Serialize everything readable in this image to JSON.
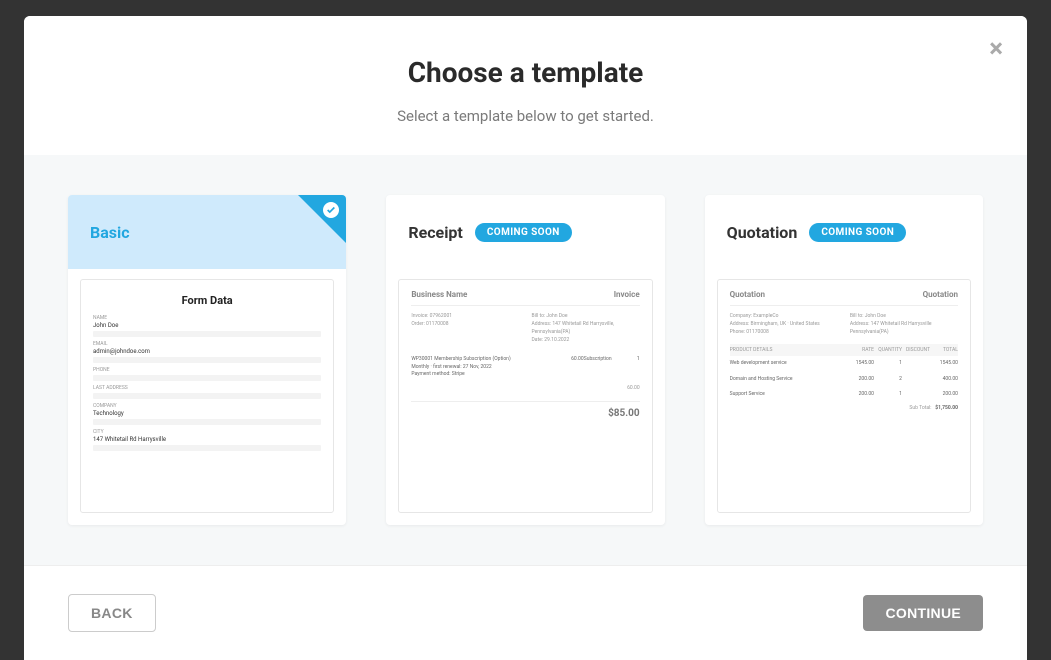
{
  "modal": {
    "title": "Choose a template",
    "subtitle": "Select a template below to get started.",
    "close_glyph": "×"
  },
  "templates": [
    {
      "name": "Basic",
      "selected": true,
      "preview": {
        "title": "Form Data",
        "fields": [
          {
            "label": "NAME",
            "value": "John Doe"
          },
          {
            "label": "EMAIL",
            "value": "admin@johndoe.com"
          },
          {
            "label": "PHONE",
            "value": ""
          },
          {
            "label": "LAST ADDRESS",
            "value": ""
          },
          {
            "label": "COMPANY",
            "value": "Technology"
          },
          {
            "label": "CITY",
            "value": "147 Whitetail Rd Harrysville"
          }
        ]
      }
    },
    {
      "name": "Receipt",
      "badge": "COMING SOON",
      "preview": {
        "doc_name": "Business Name",
        "doc_type": "Invoice",
        "left_block": [
          "Invoice: 07962001",
          "Order: 01170008"
        ],
        "right_block": [
          "Bill to: John Doe",
          "Address: 147 Whitetail Rd Harrysville, Pennsylvania(PA)",
          "Date: 29.10.2022"
        ],
        "item_line1": "WP30001 Membership Subscription (Option)",
        "item_line2": "Monthly · first renewal: 27 Nov, 2022",
        "item_line3": "Payment method: Stripe",
        "row_cols": [
          "60.00",
          "Subscription",
          "1"
        ],
        "sub_line": "60.00",
        "total": "$85.00"
      }
    },
    {
      "name": "Quotation",
      "badge": "COMING SOON",
      "preview": {
        "doc_name": "Quotation",
        "doc_type": "Quotation",
        "left_block": [
          "Company: ExampleCo",
          "Address: Birmingham, UK · United States",
          "Phone: 01170008"
        ],
        "right_block": [
          "Bill to: John Doe",
          "Address: 147 Whitetail Rd Harrysville Pennsylvania(PA)"
        ],
        "head_cols": [
          "PRODUCT DETAILS",
          "RATE",
          "QUANTITY",
          "DISCOUNT",
          "TOTAL"
        ],
        "rows": [
          {
            "name": "Web development service",
            "cols": [
              "1545.00",
              "1",
              "",
              "1545.00"
            ]
          },
          {
            "name": "Domain and Hosting Service",
            "cols": [
              "200.00",
              "2",
              "",
              "400.00"
            ]
          },
          {
            "name": "Support Service",
            "cols": [
              "200.00",
              "1",
              "",
              "200.00"
            ]
          }
        ],
        "subtotal_label": "Sub Total:",
        "subtotal": "$1,750.00"
      }
    }
  ],
  "footer": {
    "back_label": "BACK",
    "continue_label": "CONTINUE"
  }
}
